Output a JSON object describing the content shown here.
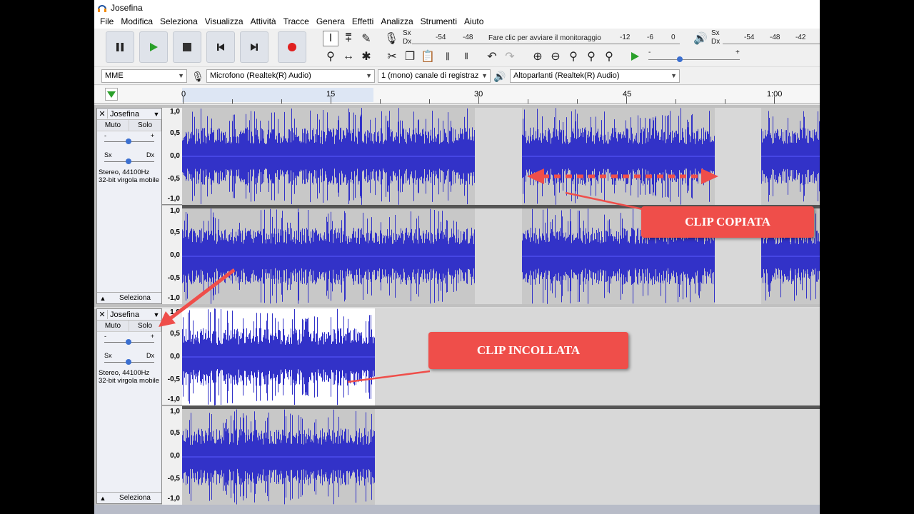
{
  "window": {
    "title": "Josefina"
  },
  "menu": [
    "File",
    "Modifica",
    "Seleziona",
    "Visualizza",
    "Attività",
    "Tracce",
    "Genera",
    "Effetti",
    "Analizza",
    "Strumenti",
    "Aiuto"
  ],
  "meters": {
    "rec_channels": [
      "Sx",
      "Dx"
    ],
    "rec_ticks": [
      "-54",
      "-48",
      "-12",
      "-6",
      "0"
    ],
    "rec_hint": "Fare clic per avviare il monitoraggio",
    "play_channels": [
      "Sx",
      "Dx"
    ],
    "play_ticks": [
      "-54",
      "-48",
      "-42"
    ]
  },
  "devices": {
    "host": "MME",
    "input": "Microfono (Realtek(R) Audio)",
    "channels": "1 (mono) canale di registraz",
    "output": "Altoparlanti (Realtek(R) Audio)"
  },
  "ruler": {
    "labels": [
      "0",
      "15",
      "30",
      "45",
      "1:00"
    ]
  },
  "tracks": [
    {
      "name": "Josefina",
      "mute": "Muto",
      "solo": "Solo",
      "gain_min": "-",
      "gain_max": "+",
      "pan_left": "Sx",
      "pan_right": "Dx",
      "info1": "Stereo, 44100Hz",
      "info2": "32-bit virgola mobile",
      "select": "Seleziona",
      "scale": [
        "1,0",
        "0,5",
        "0,0",
        "-0,5",
        "-1,0"
      ]
    },
    {
      "name": "Josefina",
      "mute": "Muto",
      "solo": "Solo",
      "gain_min": "-",
      "gain_max": "+",
      "pan_left": "Sx",
      "pan_right": "Dx",
      "info1": "Stereo, 44100Hz",
      "info2": "32-bit virgola mobile",
      "select": "Seleziona",
      "scale": [
        "1,0",
        "0,5",
        "0,0",
        "-0,5",
        "-1,0"
      ]
    }
  ],
  "annotations": {
    "copied": "CLIP COPIATA",
    "pasted": "CLIP INCOLLATA"
  },
  "colors": {
    "waveform": "#3232c8",
    "clip_bg": "#c8c8c8",
    "selected_clip_bg": "#ffffff",
    "track_empty": "#d8d8d8",
    "callout": "#ef4e4a"
  }
}
